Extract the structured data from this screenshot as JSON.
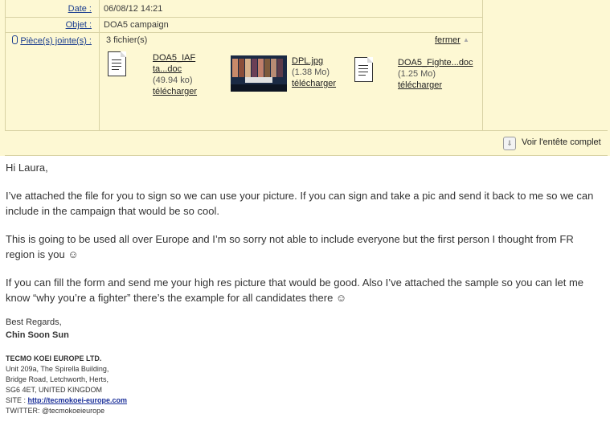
{
  "header": {
    "date_label": "Date :",
    "date_value": "06/08/12 14:21",
    "subject_label": "Objet :",
    "subject_value": "DOA5 campaign",
    "attachments_label": "Pièce(s) jointe(s) :",
    "file_count": "3 fichier(s)",
    "close_label": "fermer",
    "show_header_label": "Voir l'entête complet"
  },
  "attachments": [
    {
      "name_line1": "DOA5_IAF",
      "name_line2": "ta...doc",
      "size": "(49.94 ko)",
      "download": "télécharger",
      "icon": "document-icon"
    },
    {
      "name_line1": "DPL.jpg",
      "size": "(1.38 Mo)",
      "download": "télécharger",
      "icon": "image-thumbnail"
    },
    {
      "name_line1": "DOA5_Fighte...doc",
      "size": "(1.25 Mo)",
      "download": "télécharger",
      "icon": "document-icon"
    }
  ],
  "message": {
    "greeting": "Hi Laura,",
    "p1": "I’ve attached the file for you to sign so we can use your picture. If you can sign and take a pic and send it back to me so we can include in the campaign that would be so cool.",
    "p2": "This is going to be used all over Europe and I’m so sorry not able to include everyone but the first person I thought from FR region is you ☺",
    "p3": "If you can fill the form and send me your high res picture that would be good. Also I’ve attached the sample so you can let me know “why you’re a fighter” there’s the example for all candidates there ☺",
    "closing": "Best Regards,",
    "sender": "Chin Soon Sun"
  },
  "signature": {
    "company": "TECMO KOEI EUROPE LTD.",
    "addr1": "Unit 209a, The Spirella Building,",
    "addr2": "Bridge Road, Letchworth, Herts,",
    "addr3": "SG6 4ET, UNITED KINGDOM",
    "site_label": "SITE : ",
    "site_url": "http://tecmokoei-europe.com",
    "twitter": "TWITTER: @tecmokoeieurope"
  }
}
